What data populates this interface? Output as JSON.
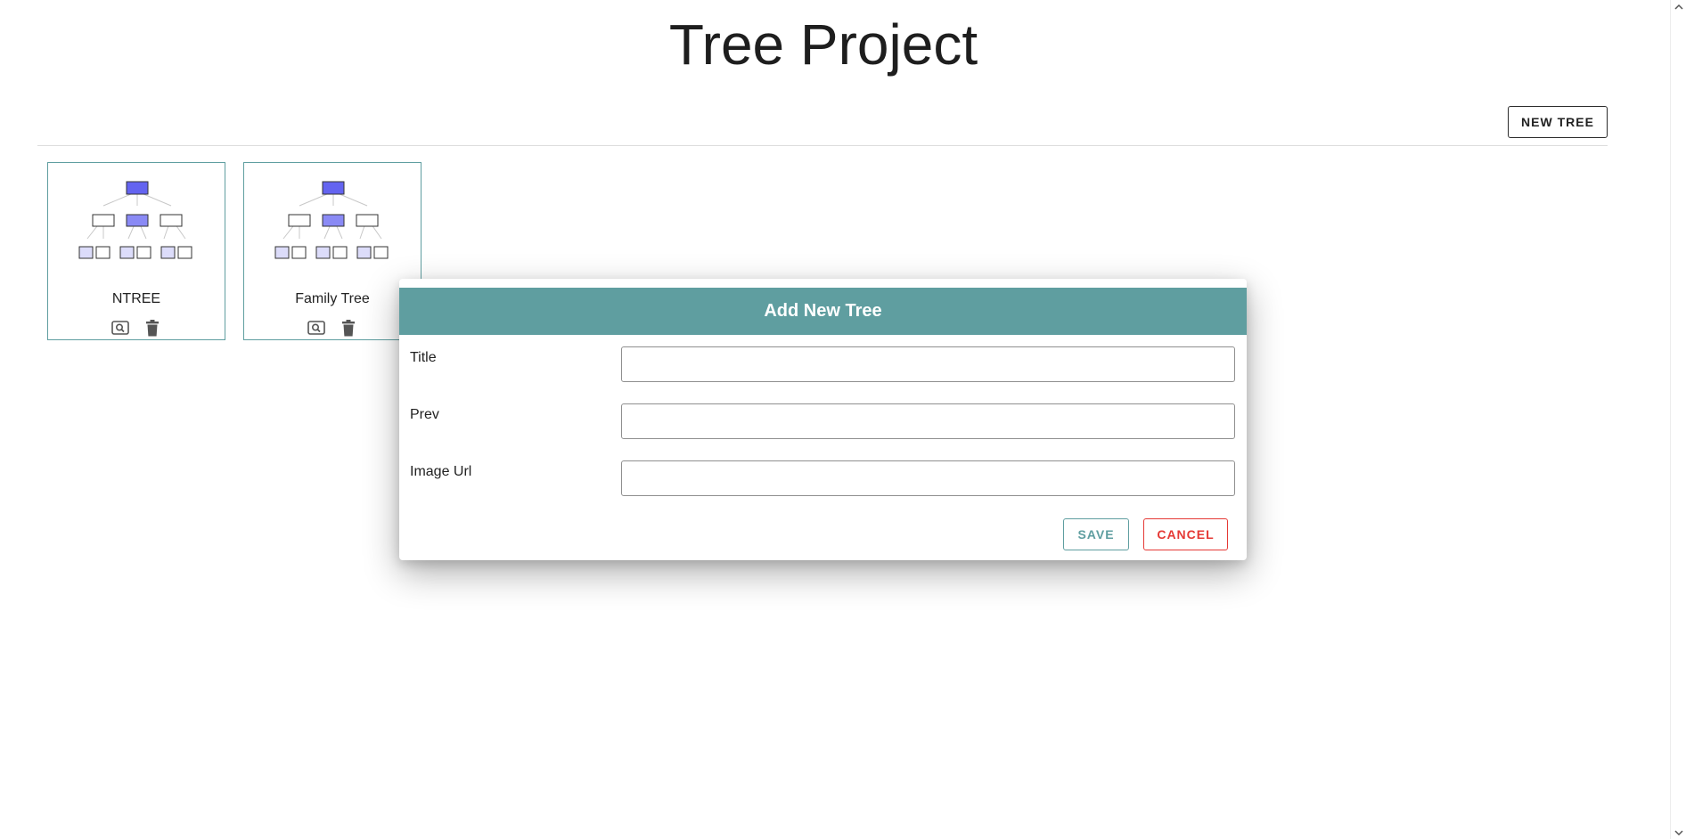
{
  "page": {
    "title": "Tree Project",
    "new_tree_label": "NEW TREE"
  },
  "trees": [
    {
      "title": "NTREE",
      "view_icon": "search-icon",
      "delete_icon": "trash-icon"
    },
    {
      "title": "Family Tree",
      "view_icon": "search-icon",
      "delete_icon": "trash-icon"
    }
  ],
  "modal": {
    "title": "Add New Tree",
    "fields": [
      {
        "label": "Title",
        "value": "",
        "placeholder": ""
      },
      {
        "label": "Prev",
        "value": "",
        "placeholder": ""
      },
      {
        "label": "Image Url",
        "value": "",
        "placeholder": ""
      }
    ],
    "save_label": "SAVE",
    "cancel_label": "CANCEL"
  },
  "colors": {
    "accent": "#5f9ea0",
    "danger": "#e53935",
    "node_dark": "#6464f0",
    "node_mid": "#8a8af5",
    "node_light": "#dcdcfa"
  },
  "scrollbar": {
    "up_icon": "chevron-up-icon",
    "down_icon": "chevron-down-icon"
  }
}
